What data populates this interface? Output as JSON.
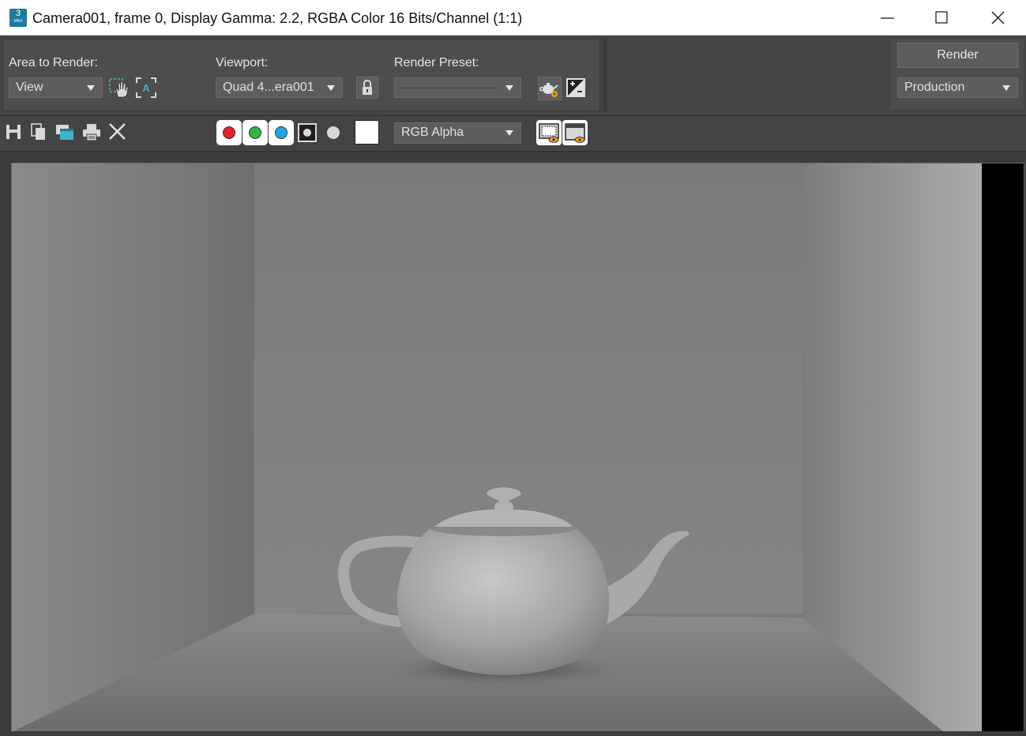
{
  "window": {
    "title": "Camera001, frame 0, Display Gamma: 2.2, RGBA Color 16 Bits/Channel (1:1)",
    "app_icon_text": "3",
    "app_icon_sub": "MAX"
  },
  "panel": {
    "area_label": "Area to Render:",
    "area_value": "View",
    "viewport_label": "Viewport:",
    "viewport_value": "Quad 4...era001",
    "preset_label": "Render Preset:",
    "preset_value": "",
    "render_button": "Render",
    "render_mode": "Production"
  },
  "toolbar": {
    "channel_display": "RGB Alpha"
  },
  "colors": {
    "red_channel": "#e8202a",
    "green_channel": "#2fb544",
    "blue_channel": "#1fa7e0",
    "accent_teal": "#3fb4c7",
    "accent_orange": "#f0a020"
  }
}
